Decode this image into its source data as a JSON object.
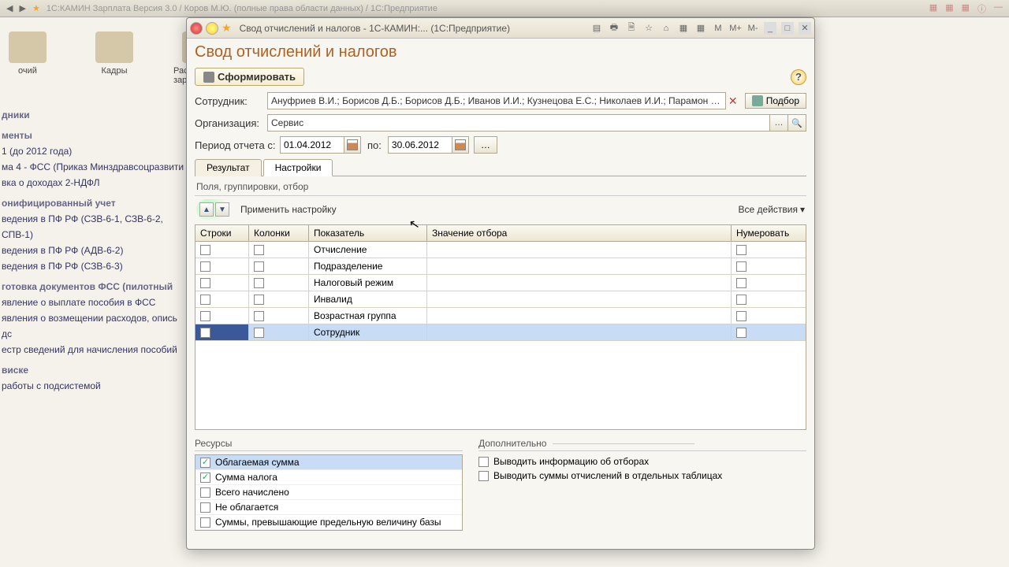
{
  "topbar": {
    "title_blur": "1С:КАМИН Зарплата Версия 3.0 / Коров М.Ю. (полные права области данных) / 1С:Предприятие"
  },
  "desktop": {
    "icons": [
      "очий",
      "Кадры",
      "Расчет зарплаты"
    ]
  },
  "sidebar": {
    "groups": [
      {
        "head": "дники",
        "items": []
      },
      {
        "head": "менты",
        "items": [
          "1 (до 2012 года)",
          "",
          "ма 4 - ФСС (Приказ Минздравсоцразвити",
          "вка о доходах 2-НДФЛ"
        ]
      },
      {
        "head": "онифицированный учет",
        "items": [
          "ведения в ПФ РФ (СЗВ-6-1, СЗВ-6-2, СПВ-1)",
          "ведения в ПФ РФ (АДВ-6-2)",
          "ведения в ПФ РФ (СЗВ-6-3)"
        ]
      },
      {
        "head": "готовка документов ФСС (пилотный",
        "items": [
          "явление о выплате пособия в ФСС",
          "явления о возмещении расходов, опись дс",
          "естр сведений для начисления пособий"
        ]
      },
      {
        "head": "виске",
        "items": [
          "работы с подсистемой"
        ]
      }
    ]
  },
  "window": {
    "title": "Свод отчислений и налогов - 1С-КАМИН:...   (1С:Предприятие)",
    "page_title": "Свод отчислений и налогов",
    "form_btn": "Сформировать",
    "labels": {
      "employee": "Сотрудник:",
      "org": "Организация:",
      "period_from": "Период отчета с:",
      "period_to": "по:"
    },
    "employee_value": "Ануфриев В.И.; Борисов Д.Б.; Борисов Д.Б.; Иванов И.И.; Кузнецова Е.С.; Николаев И.И.; Парамон …",
    "org_value": "Сервис",
    "date_from": "01.04.2012",
    "date_to": "30.06.2012",
    "podvor": "Подбор",
    "tabs": {
      "result": "Результат",
      "settings": "Настройки"
    },
    "section1": "Поля, группировки, отбор",
    "apply": "Применить настройку",
    "all_actions": "Все действия",
    "grid": {
      "headers": {
        "rows": "Строки",
        "cols": "Колонки",
        "indicator": "Показатель",
        "filter": "Значение отбора",
        "number": "Нумеровать"
      },
      "rows": [
        {
          "label": "Отчисление"
        },
        {
          "label": "Подразделение"
        },
        {
          "label": "Налоговый режим"
        },
        {
          "label": "Инвалид"
        },
        {
          "label": "Возрастная группа"
        },
        {
          "label": "Сотрудник",
          "selected": true
        }
      ]
    },
    "resources": {
      "title": "Ресурсы",
      "items": [
        {
          "label": "Облагаемая сумма",
          "checked": true,
          "selected": true
        },
        {
          "label": "Сумма налога",
          "checked": true
        },
        {
          "label": "Всего начислено"
        },
        {
          "label": "Не облагается"
        },
        {
          "label": "Суммы, превышающие предельную величину базы"
        }
      ]
    },
    "additional": {
      "title": "Дополнительно",
      "items": [
        {
          "label": "Выводить информацию об отборах"
        },
        {
          "label": "Выводить суммы отчислений в отдельных таблицах"
        }
      ]
    }
  }
}
